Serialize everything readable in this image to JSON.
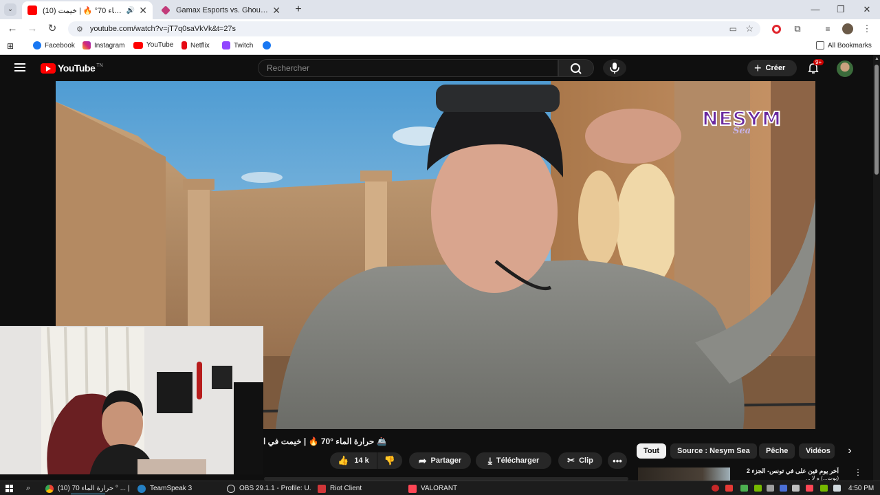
{
  "browser": {
    "tabs": [
      {
        "title": "(10) حرارة الماء 70° 🔥 | خيمت...",
        "active": true
      },
      {
        "title": "Gamax Esports vs. Ghouls Espo",
        "active": false
      }
    ],
    "url": "youtube.com/watch?v=jT7q0saVkVk&t=27s",
    "bookmarks": [
      "Facebook",
      "Instagram",
      "YouTube",
      "Netflix",
      "Twitch"
    ],
    "all_bookmarks": "All Bookmarks"
  },
  "youtube": {
    "logo": "YouTube",
    "logo_suffix": "TN",
    "search_placeholder": "Rechercher",
    "create_label": "Créer",
    "notif_badge": "9+"
  },
  "video": {
    "watermark_main": "NESYM",
    "watermark_sub": "Sea",
    "title": "🚢 حرارة الماء °70 🔥 | خيمت في ا",
    "likes": "14 k",
    "share": "Partager",
    "download": "Télécharger",
    "clip": "Clip"
  },
  "chips": [
    "Tout",
    "Source : Nesym Sea",
    "Pêche",
    "Vidéos"
  ],
  "recommendation": {
    "title": "آخر يوم فين على في تونس- الجزء 2",
    "line2": "(بوت...) ه لا ..."
  },
  "taskbar": {
    "items": [
      "(10) حرارة الماء 70 ° ... |",
      "TeamSpeak 3",
      "OBS 29.1.1 - Profile: U...",
      "Riot Client",
      "VALORANT"
    ],
    "time": "4:50 PM"
  },
  "colors": {
    "yt_red": "#ff0000",
    "dark_bg": "#0f0f0f",
    "chip_bg": "#272727",
    "chrome_tab": "#dfe3eb"
  }
}
